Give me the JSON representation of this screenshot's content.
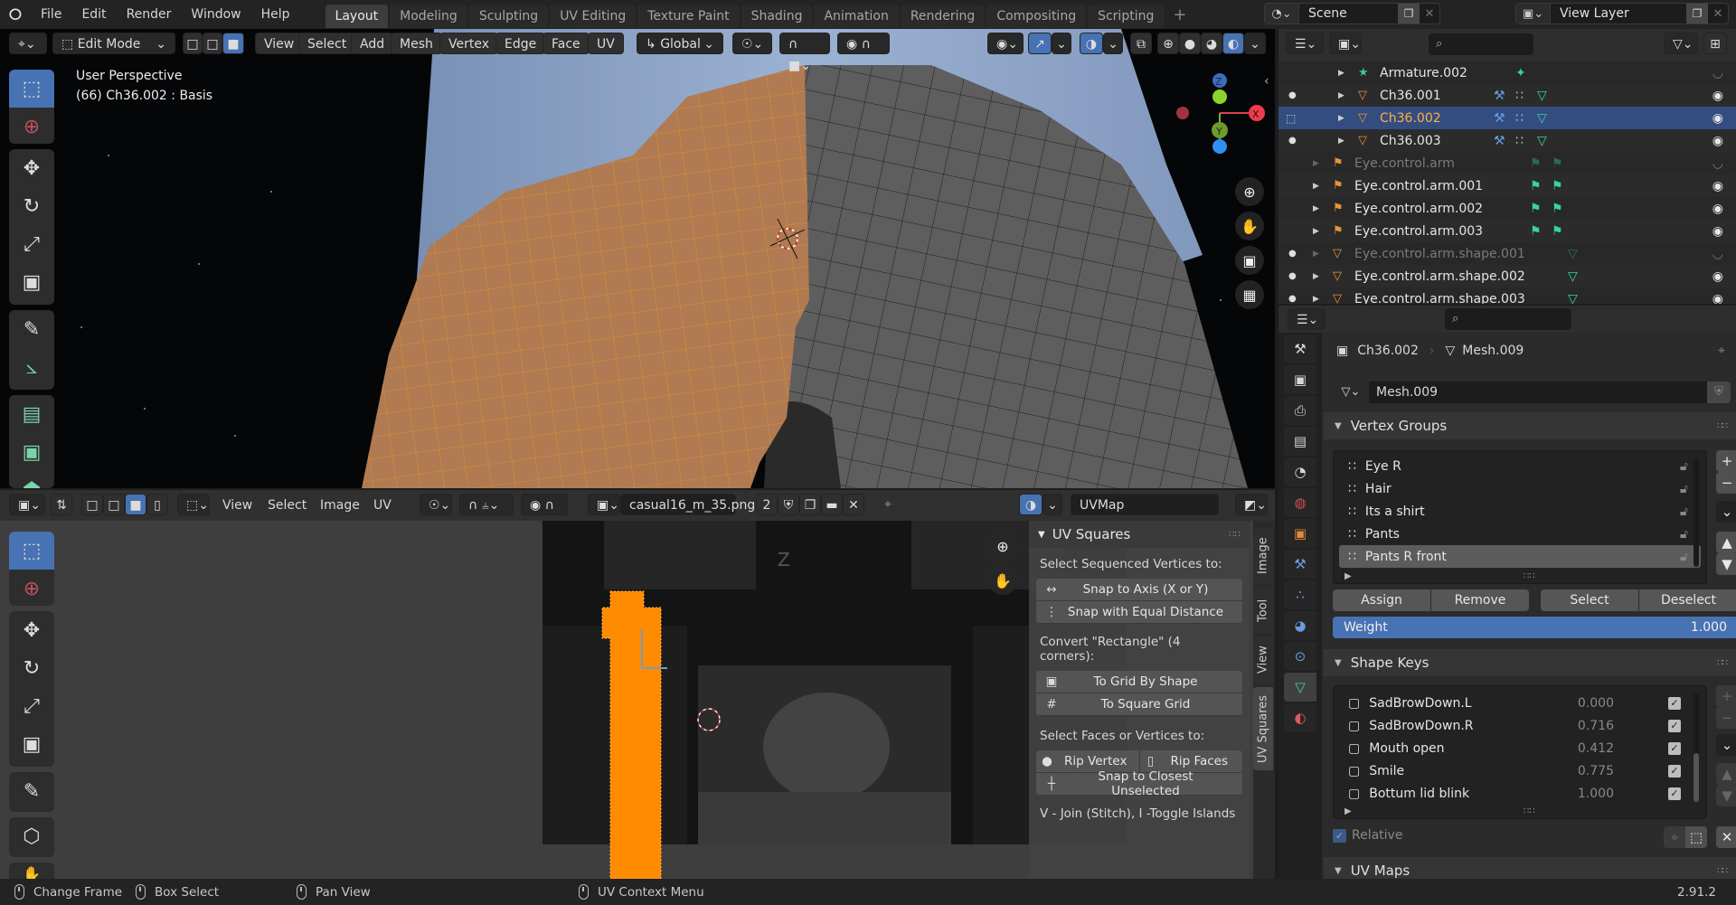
{
  "app": {
    "logo": "blender-logo-icon",
    "menus": [
      "File",
      "Edit",
      "Render",
      "Window",
      "Help"
    ],
    "workspaces": [
      "Layout",
      "Modeling",
      "Sculpting",
      "UV Editing",
      "Texture Paint",
      "Shading",
      "Animation",
      "Rendering",
      "Compositing",
      "Scripting"
    ],
    "active_workspace": "Layout",
    "add_workspace": "+",
    "scene": "Scene",
    "view_layer": "View Layer",
    "version": "2.91.2"
  },
  "viewport": {
    "mode": "Edit Mode",
    "menus": [
      "View",
      "Select",
      "Add",
      "Mesh",
      "Vertex",
      "Edge",
      "Face",
      "UV"
    ],
    "transform_orientation": "Global",
    "overlay_title": "User Perspective",
    "overlay_subtitle": "(66) Ch36.002 : Basis",
    "gizmo": {
      "x": "X",
      "y": "Y",
      "z": "Z"
    },
    "tools": [
      "select-box",
      "cursor",
      "move",
      "rotate",
      "scale",
      "transform",
      "annotate",
      "measure",
      "extrude-region",
      "inset-faces",
      "bevel"
    ],
    "colors": {
      "selected_mesh": "#c87a2e",
      "unselected_mesh": "#5a5a5a",
      "cloth": "#8fa6c8",
      "active_tab": "#4772b3"
    }
  },
  "uv_editor": {
    "menus": [
      "View",
      "Select",
      "Image",
      "UV"
    ],
    "image_name": "casual16_m_35.png...",
    "image_users": "2",
    "uv_map": "UVMap",
    "tools": [
      "select-box",
      "cursor",
      "move",
      "rotate",
      "scale",
      "transform",
      "annotate",
      "rip",
      "grab"
    ],
    "side_tabs": [
      "Image",
      "Tool",
      "View",
      "UV Squares"
    ],
    "active_side_tab": "UV Squares",
    "uv_island_color": "#ff8c00",
    "panel": {
      "title": "UV Squares",
      "section1": "Select Sequenced Vertices to:",
      "snap_axis": "Snap to Axis (X or Y)",
      "snap_equal": "Snap with Equal Distance",
      "section2": "Convert \"Rectangle\" (4 corners):",
      "grid_by_shape": "To Grid By Shape",
      "square_grid": "To Square Grid",
      "section3": "Select Faces or Vertices to:",
      "rip_vertex": "Rip Vertex",
      "rip_faces": "Rip Faces",
      "snap_closest": "Snap to Closest Unselected",
      "hint": "V - Join (Stitch), I -Toggle Islands"
    }
  },
  "outliner": {
    "rows": [
      {
        "name": "Armature.002",
        "type": "armature",
        "indent": 2,
        "dot": false,
        "eye": false,
        "dim": false,
        "selected": false
      },
      {
        "name": "Ch36.001",
        "type": "mesh",
        "indent": 2,
        "dot": true,
        "eye": true,
        "dim": false,
        "selected": false
      },
      {
        "name": "Ch36.002",
        "type": "mesh",
        "indent": 2,
        "dot": false,
        "eye": true,
        "dim": false,
        "selected": true
      },
      {
        "name": "Ch36.003",
        "type": "mesh",
        "indent": 2,
        "dot": true,
        "eye": true,
        "dim": false,
        "selected": false
      },
      {
        "name": "Eye.control.arm",
        "type": "armature-obj",
        "indent": 1,
        "dot": false,
        "eye": false,
        "dim": true,
        "selected": false
      },
      {
        "name": "Eye.control.arm.001",
        "type": "armature-obj",
        "indent": 1,
        "dot": false,
        "eye": true,
        "dim": false,
        "selected": false
      },
      {
        "name": "Eye.control.arm.002",
        "type": "armature-obj",
        "indent": 1,
        "dot": false,
        "eye": true,
        "dim": false,
        "selected": false
      },
      {
        "name": "Eye.control.arm.003",
        "type": "armature-obj",
        "indent": 1,
        "dot": false,
        "eye": true,
        "dim": false,
        "selected": false
      },
      {
        "name": "Eye.control.arm.shape.001",
        "type": "mesh",
        "indent": 1,
        "dot": true,
        "eye": false,
        "dim": true,
        "selected": false
      },
      {
        "name": "Eye.control.arm.shape.002",
        "type": "mesh",
        "indent": 1,
        "dot": true,
        "eye": true,
        "dim": false,
        "selected": false
      },
      {
        "name": "Eye.control.arm.shape.003",
        "type": "mesh",
        "indent": 1,
        "dot": true,
        "eye": true,
        "dim": false,
        "selected": false
      }
    ]
  },
  "properties": {
    "breadcrumb_object": "Ch36.002",
    "breadcrumb_data": "Mesh.009",
    "mesh_name": "Mesh.009",
    "vertex_groups": {
      "title": "Vertex Groups",
      "items": [
        "Eye R",
        "Hair",
        "Its a shirt",
        "Pants",
        "Pants R front"
      ],
      "active": "Pants R front",
      "assign": "Assign",
      "remove": "Remove",
      "select": "Select",
      "deselect": "Deselect",
      "weight_label": "Weight",
      "weight_value": "1.000"
    },
    "shape_keys": {
      "title": "Shape Keys",
      "items": [
        {
          "name": "SadBrowDown.L",
          "value": "0.000",
          "enabled": true
        },
        {
          "name": "SadBrowDown.R",
          "value": "0.716",
          "enabled": true
        },
        {
          "name": "Mouth open",
          "value": "0.412",
          "enabled": true
        },
        {
          "name": "Smile",
          "value": "0.775",
          "enabled": true
        },
        {
          "name": "Bottum lid blink",
          "value": "1.000",
          "enabled": true
        }
      ],
      "relative_label": "Relative"
    },
    "uv_maps": {
      "title": "UV Maps"
    }
  },
  "statusbar": {
    "items": [
      "Change Frame",
      "Box Select",
      "Pan View",
      "UV Context Menu"
    ]
  }
}
